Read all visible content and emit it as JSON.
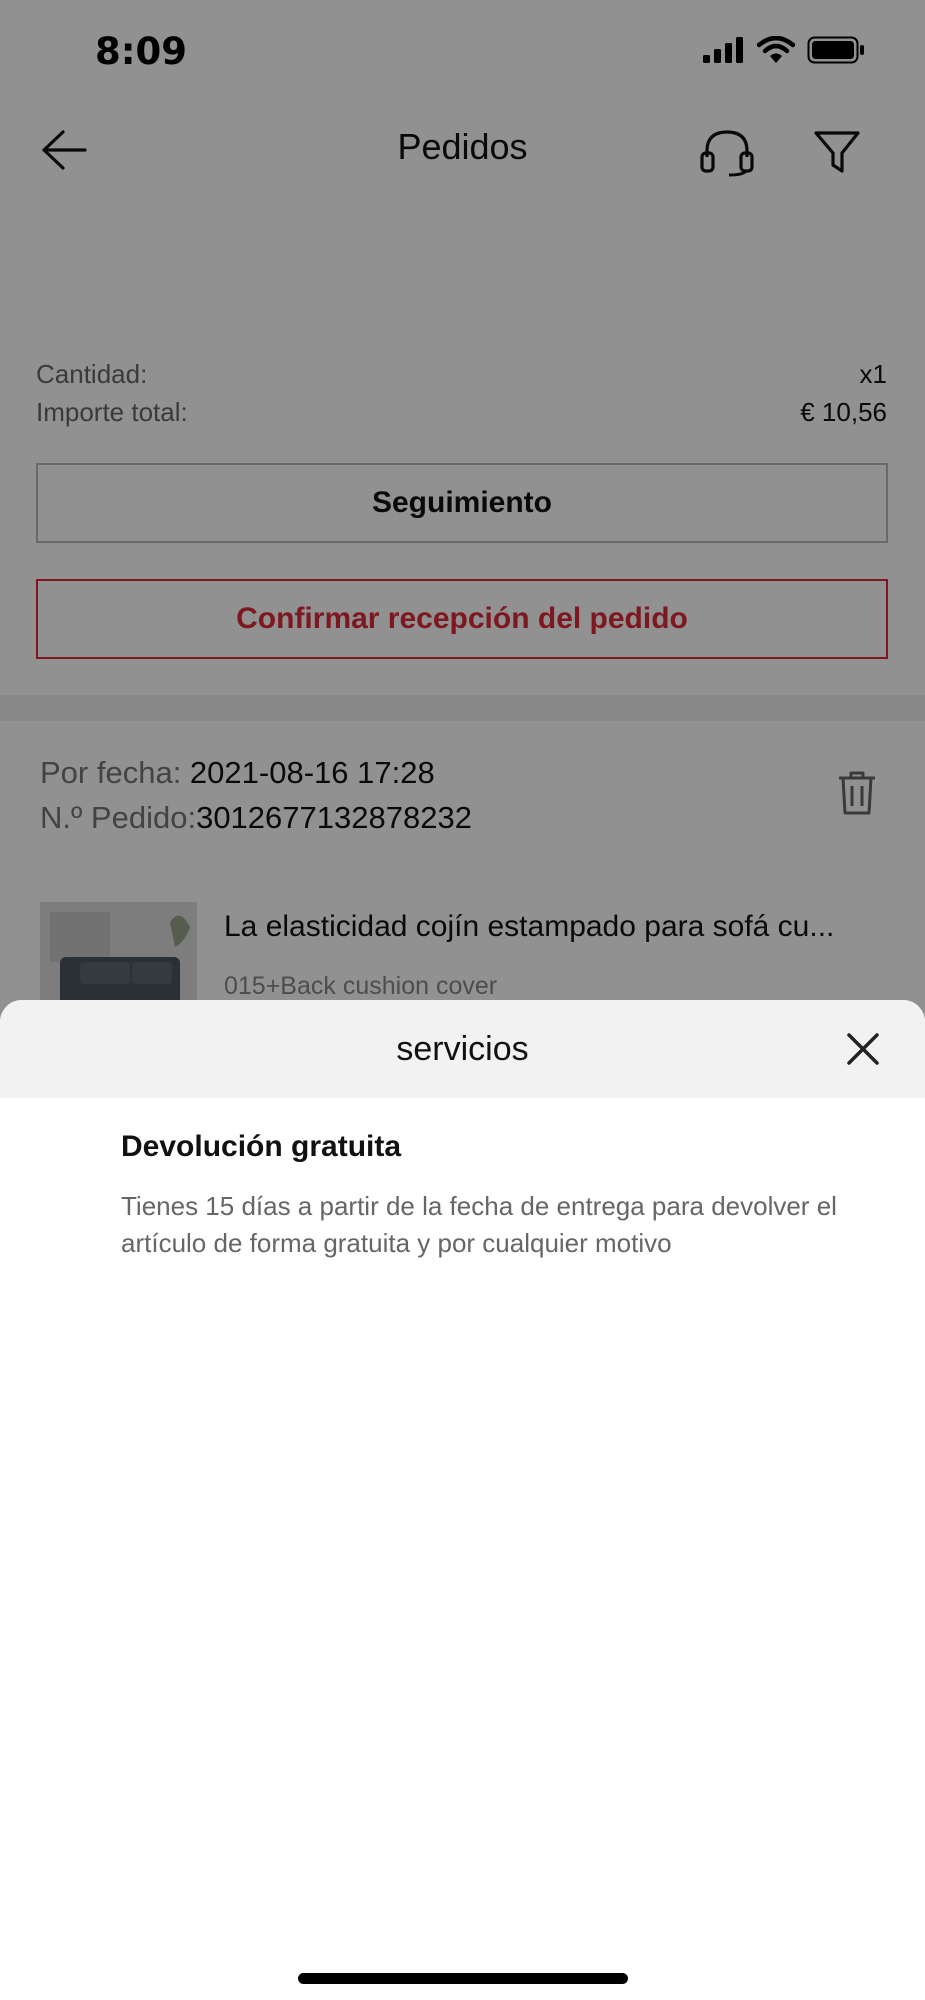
{
  "status_bar": {
    "time": "8:09"
  },
  "nav": {
    "title": "Pedidos"
  },
  "order_summary": {
    "quantity_label": "Cantidad:",
    "quantity_value": "x1",
    "total_label": "Importe total:",
    "total_value": "€ 10,56"
  },
  "buttons": {
    "tracking": "Seguimiento",
    "confirm_receipt": "Confirmar recepción del pedido"
  },
  "order2": {
    "date_label": "Por fecha:",
    "date_value": " 2021-08-16 17:28",
    "order_label": "N.º Pedido:",
    "order_value": "3012677132878232",
    "product_title": "La elasticidad cojín estampado para sofá cu...",
    "product_variant": "015+Back cushion cover"
  },
  "sheet": {
    "title": "servicios",
    "service_title": "Devolución gratuita",
    "service_desc": "Tienes 15 días a partir de la fecha de entrega para devolver el artículo de forma gratuita y por cualquier motivo"
  },
  "colors": {
    "accent": "#e02a3a",
    "overlay": "rgba(0,0,0,0.43)",
    "sheet_header": "#f2f2f2"
  },
  "icons": [
    "signal-icon",
    "wifi-icon",
    "battery-icon",
    "back-arrow-icon",
    "headset-icon",
    "filter-icon",
    "trash-icon",
    "close-icon"
  ]
}
